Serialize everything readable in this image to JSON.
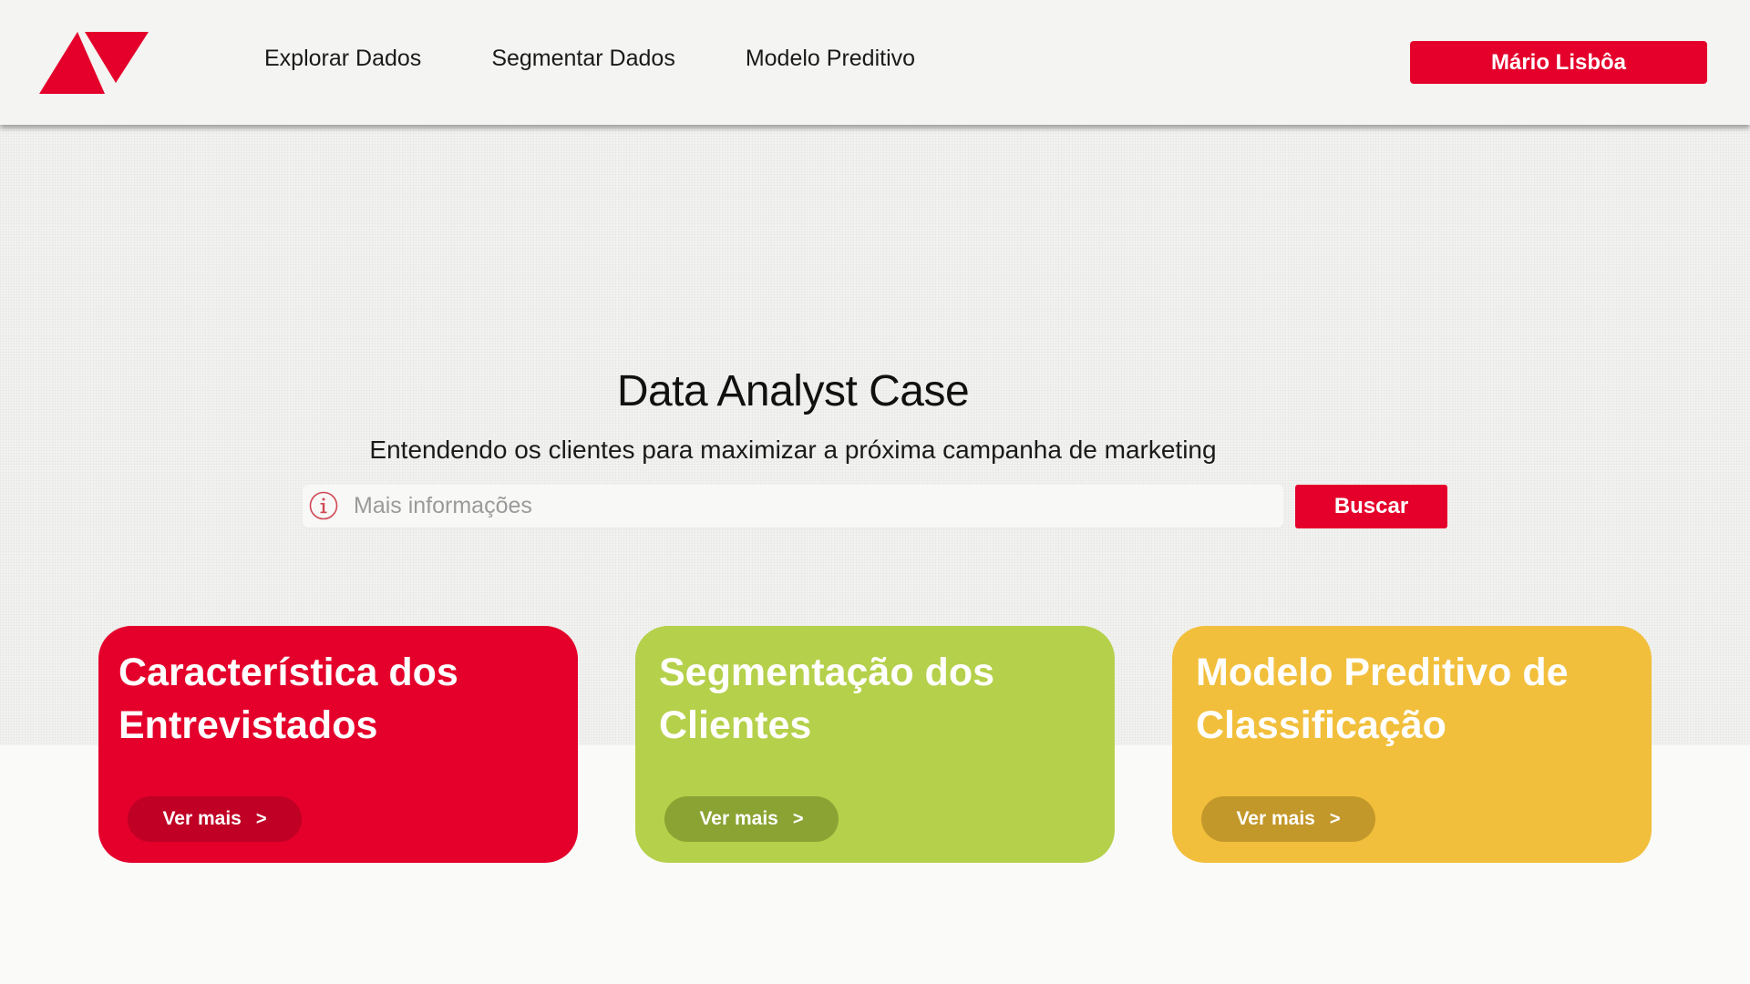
{
  "colors": {
    "brand_red": "#e4002b",
    "green": "#b5d04a",
    "yellow": "#f2bf3c",
    "background": "#f2f2f0"
  },
  "header": {
    "logo_icon": "triangle-logo",
    "nav": [
      {
        "label": "Explorar Dados"
      },
      {
        "label": "Segmentar Dados"
      },
      {
        "label": "Modelo Preditivo"
      }
    ],
    "user_button": "Mário Lisbôa"
  },
  "hero": {
    "title": "Data Analyst Case",
    "subtitle": "Entendendo os clientes para maximizar a próxima campanha de marketing",
    "search": {
      "icon": "info-icon",
      "placeholder": "Mais informações",
      "value": "",
      "button": "Buscar"
    }
  },
  "cards": [
    {
      "title": "Característica dos Entrevistados",
      "button": "Ver mais",
      "chevron": ">",
      "color": "#e4002b"
    },
    {
      "title": "Segmentação dos Clientes",
      "button": "Ver mais",
      "chevron": ">",
      "color": "#b5d04a"
    },
    {
      "title": "Modelo Preditivo de Classificação",
      "button": "Ver mais",
      "chevron": ">",
      "color": "#f2bf3c"
    }
  ]
}
